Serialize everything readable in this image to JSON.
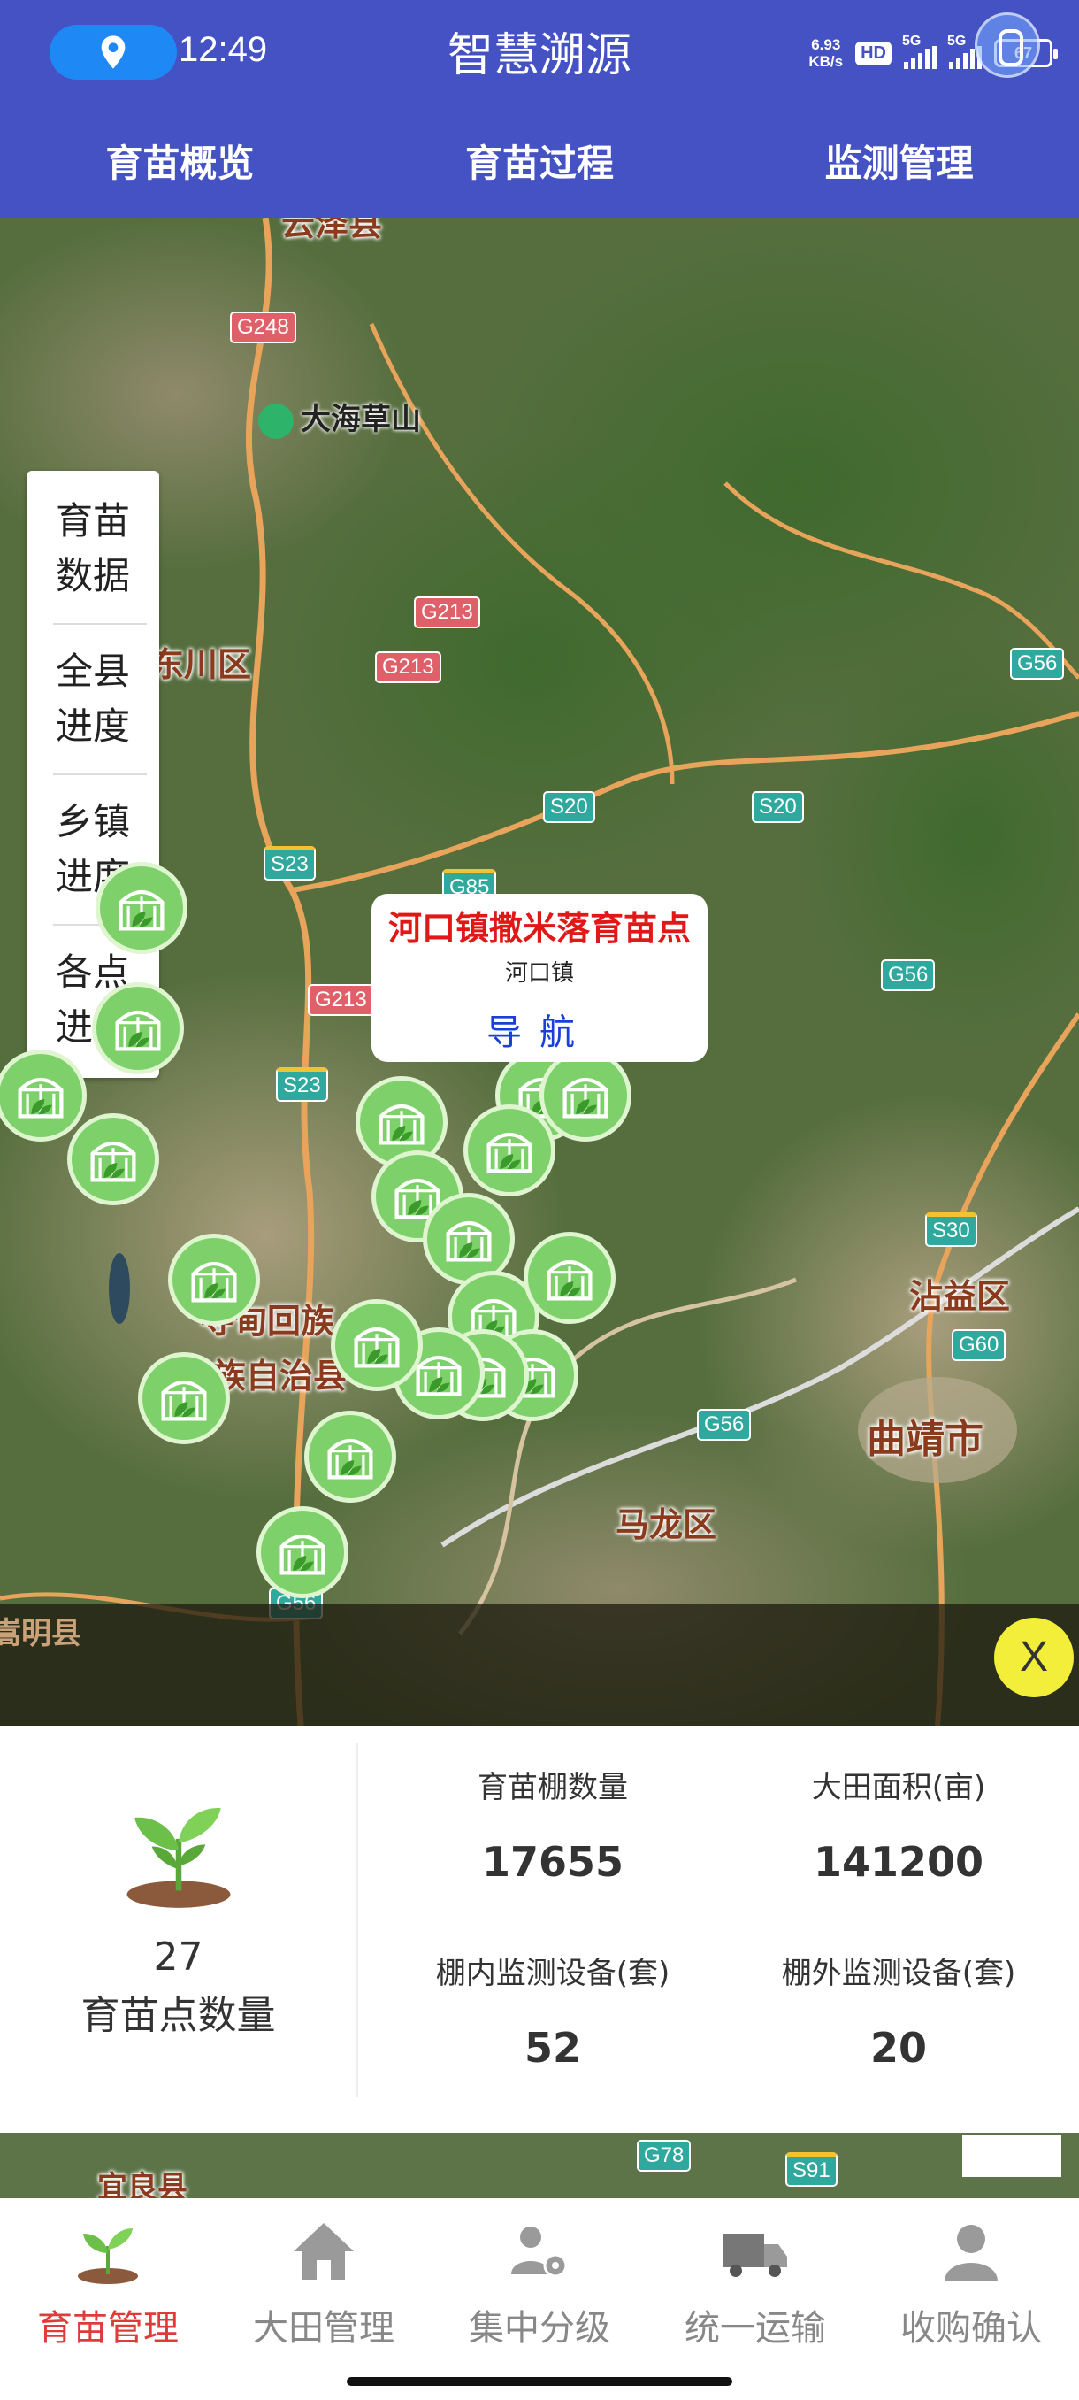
{
  "status_bar": {
    "time": "12:49",
    "net_speed_value": "6.93",
    "net_speed_unit": "KB/s",
    "hd_label": "HD",
    "signal_1": "5G",
    "signal_2": "5G",
    "battery": "67"
  },
  "header": {
    "title": "智慧溯源",
    "tabs": [
      {
        "label": "育苗概览"
      },
      {
        "label": "育苗过程"
      },
      {
        "label": "监测管理"
      }
    ]
  },
  "map": {
    "side_menu": [
      {
        "line1": "育苗",
        "line2": "数据"
      },
      {
        "line1": "全县",
        "line2": "进度"
      },
      {
        "line1": "乡镇",
        "line2": "进度"
      },
      {
        "line1": "各点",
        "line2": "进度"
      }
    ],
    "place_labels": {
      "p1": "云泽县",
      "p2": "大海草山",
      "p3": "东川区",
      "p4": "沾益区",
      "p5": "曲靖市",
      "p6": "马龙区",
      "p7": "寻甸回族",
      "p8": "族自治县",
      "p9": "嵩明县",
      "p10": "宜良县"
    },
    "road_labels": {
      "r1": "G248",
      "r2": "G213",
      "r3": "G213",
      "r4": "G56",
      "r5": "S20",
      "r6": "S20",
      "r7": "S23",
      "r8": "G85",
      "r9": "G56",
      "r10": "G213",
      "r11": "S23",
      "r12": "S30",
      "r13": "G60",
      "r14": "G56",
      "r15": "G56",
      "r16": "G78",
      "r17": "S91"
    },
    "popup": {
      "title": "河口镇撒米落育苗点",
      "subtitle": "河口镇",
      "nav_label": "导航"
    },
    "close_label": "X",
    "marker_icon": "greenhouse-icon"
  },
  "stats": {
    "seedling_points_count": "27",
    "seedling_points_label": "育苗点数量",
    "cells": [
      {
        "label": "育苗棚数量",
        "value": "17655"
      },
      {
        "label": "大田面积(亩)",
        "value": "141200"
      },
      {
        "label": "棚内监测设备(套)",
        "value": "52"
      },
      {
        "label": "棚外监测设备(套)",
        "value": "20"
      }
    ]
  },
  "bottom_nav": [
    {
      "label": "育苗管理",
      "icon": "seedling-icon",
      "active": true
    },
    {
      "label": "大田管理",
      "icon": "house-icon",
      "active": false
    },
    {
      "label": "集中分级",
      "icon": "users-gear-icon",
      "active": false
    },
    {
      "label": "统一运输",
      "icon": "truck-icon",
      "active": false
    },
    {
      "label": "收购确认",
      "icon": "person-icon",
      "active": false
    }
  ],
  "colors": {
    "header_bg": "#4452c4",
    "active_tab": "#e03b3b",
    "popup_title": "#e01818",
    "popup_nav": "#1a3fd9",
    "marker": "#7ed16a",
    "close_button": "#f2ee3a"
  }
}
